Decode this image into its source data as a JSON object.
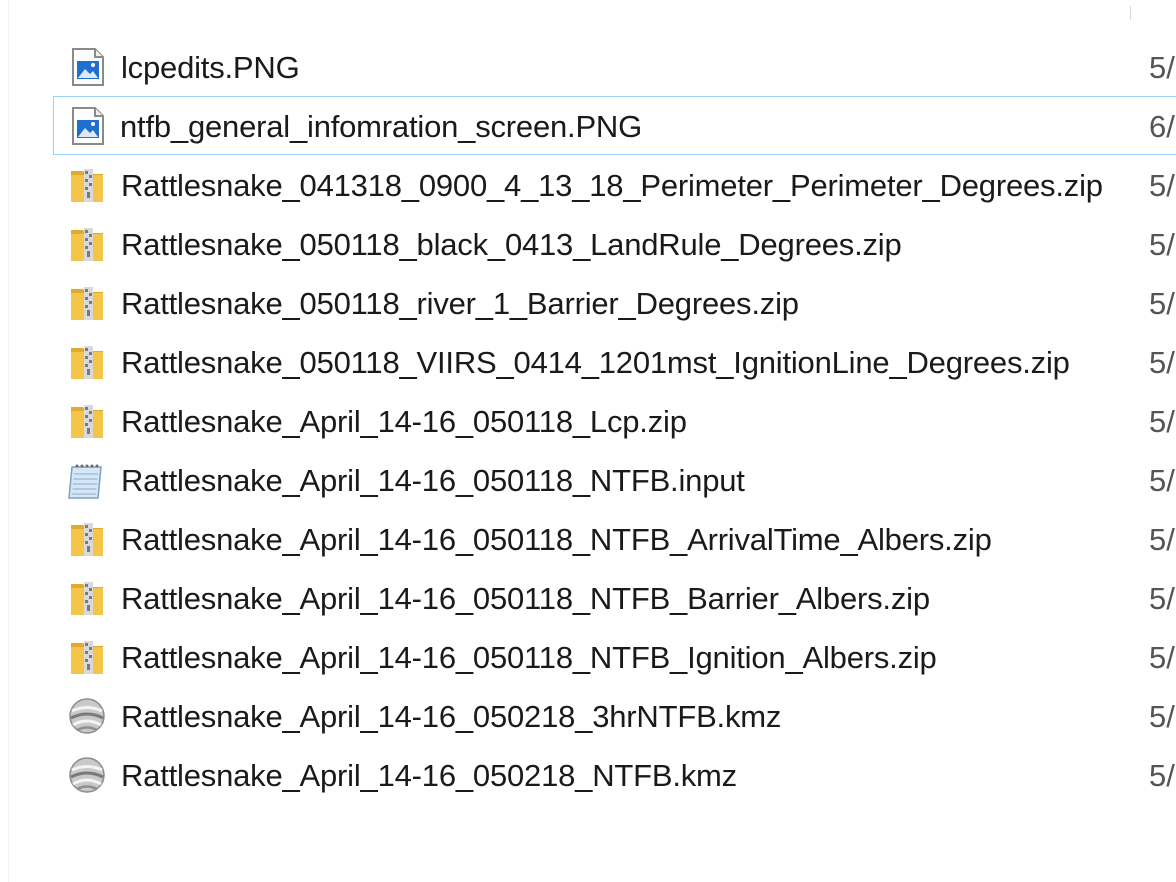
{
  "files": [
    {
      "name": "lcpedits.PNG",
      "date": "5/",
      "icon": "image-file-icon"
    },
    {
      "name": "ntfb_general_infomration_screen.PNG",
      "date": "6/",
      "icon": "image-file-icon"
    },
    {
      "name": "Rattlesnake_041318_0900_4_13_18_Perimeter_Perimeter_Degrees.zip",
      "date": "5/",
      "icon": "zip-folder-icon"
    },
    {
      "name": "Rattlesnake_050118_black_0413_LandRule_Degrees.zip",
      "date": "5/",
      "icon": "zip-folder-icon"
    },
    {
      "name": "Rattlesnake_050118_river_1_Barrier_Degrees.zip",
      "date": "5/",
      "icon": "zip-folder-icon"
    },
    {
      "name": "Rattlesnake_050118_VIIRS_0414_1201mst_IgnitionLine_Degrees.zip",
      "date": "5/",
      "icon": "zip-folder-icon"
    },
    {
      "name": "Rattlesnake_April_14-16_050118_Lcp.zip",
      "date": "5/",
      "icon": "zip-folder-icon"
    },
    {
      "name": "Rattlesnake_April_14-16_050118_NTFB.input",
      "date": "5/",
      "icon": "notepad-file-icon"
    },
    {
      "name": "Rattlesnake_April_14-16_050118_NTFB_ArrivalTime_Albers.zip",
      "date": "5/",
      "icon": "zip-folder-icon"
    },
    {
      "name": "Rattlesnake_April_14-16_050118_NTFB_Barrier_Albers.zip",
      "date": "5/",
      "icon": "zip-folder-icon"
    },
    {
      "name": "Rattlesnake_April_14-16_050118_NTFB_Ignition_Albers.zip",
      "date": "5/",
      "icon": "zip-folder-icon"
    },
    {
      "name": "Rattlesnake_April_14-16_050218_3hrNTFB.kmz",
      "date": "5/",
      "icon": "globe-file-icon"
    },
    {
      "name": "Rattlesnake_April_14-16_050218_NTFB.kmz",
      "date": "5/",
      "icon": "globe-file-icon"
    }
  ],
  "selected_index": 1,
  "colors": {
    "selection_border": "#99d1ff",
    "folder_yellow": "#f5c54a",
    "image_icon_blue": "#1f6fd1"
  }
}
